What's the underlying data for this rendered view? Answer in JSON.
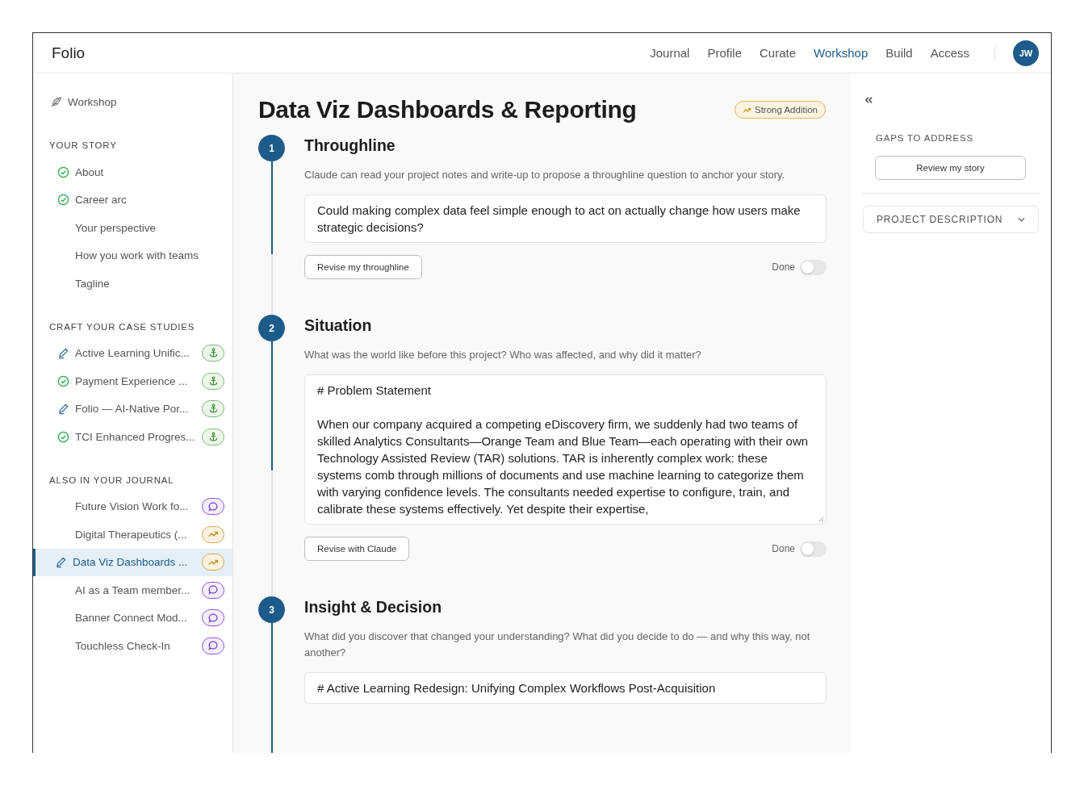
{
  "app": {
    "name": "Folio"
  },
  "nav": [
    {
      "label": "Journal",
      "selected": false
    },
    {
      "label": "Profile",
      "selected": false
    },
    {
      "label": "Curate",
      "selected": false
    },
    {
      "label": "Workshop",
      "selected": true
    },
    {
      "label": "Build",
      "selected": false
    },
    {
      "label": "Access",
      "selected": false
    }
  ],
  "avatar": {
    "initials": "JW"
  },
  "sidebar": {
    "title": "Workshop",
    "groups": [
      {
        "heading": "YOUR STORY",
        "items": [
          {
            "label": "About",
            "kind": "complete",
            "selected": false
          },
          {
            "label": "Career arc",
            "kind": "complete",
            "selected": false
          },
          {
            "label": "Your perspective",
            "kind": "plain",
            "selected": false
          },
          {
            "label": "How you work with teams",
            "kind": "plain",
            "selected": false
          },
          {
            "label": "Tagline",
            "kind": "plain",
            "selected": false
          }
        ]
      },
      {
        "heading": "CRAFT YOUR CASE STUDIES",
        "items": [
          {
            "label": "Active Learning Unific...",
            "kind": "editing",
            "badge": {
              "kind": "anchor"
            },
            "selected": false
          },
          {
            "label": "Payment Experience ...",
            "kind": "complete",
            "badge": {
              "kind": "anchor"
            },
            "selected": false
          },
          {
            "label": "Folio — AI-Native Por...",
            "kind": "editing",
            "badge": {
              "kind": "anchor"
            },
            "selected": false
          },
          {
            "label": "TCI Enhanced Progres...",
            "kind": "complete",
            "badge": {
              "kind": "anchor"
            },
            "selected": false
          }
        ]
      },
      {
        "heading": "ALSO IN YOUR JOURNAL",
        "items": [
          {
            "label": "Future Vision Work fo...",
            "kind": "plain",
            "badge": {
              "kind": "chat"
            },
            "selected": false
          },
          {
            "label": "Digital Therapeutics (...",
            "kind": "plain",
            "badge": {
              "kind": "trend"
            },
            "selected": false
          },
          {
            "label": "Data Viz Dashboards ...",
            "kind": "editing",
            "badge": {
              "kind": "trend"
            },
            "selected": true
          },
          {
            "label": "AI as a Team member...",
            "kind": "plain",
            "badge": {
              "kind": "chat"
            },
            "selected": false
          },
          {
            "label": "Banner Connect Mod...",
            "kind": "plain",
            "badge": {
              "kind": "chat"
            },
            "selected": false
          },
          {
            "label": "Touchless Check-In",
            "kind": "plain",
            "badge": {
              "kind": "chat"
            },
            "selected": false
          }
        ]
      }
    ]
  },
  "page": {
    "title": "Data Viz Dashboards & Reporting",
    "tag": "Strong Addition"
  },
  "steps": [
    {
      "number": "1",
      "title": "Throughline",
      "prompt": "Claude can read your project notes and write-up to propose a throughline question to anchor your story.",
      "value": "Could making complex data feel simple enough to act on actually change how users make strategic decisions?",
      "button": "Revise my throughline",
      "done_label": "Done",
      "done": false
    },
    {
      "number": "2",
      "title": "Situation",
      "prompt": "What was the world like before this project? Who was affected, and why did it matter?",
      "value": "# Problem Statement\n\nWhen our company acquired a competing eDiscovery firm, we suddenly had two teams of skilled Analytics Consultants—Orange Team and Blue Team—each operating with their own Technology Assisted Review (TAR) solutions. TAR is inherently complex work: these systems comb through millions of documents and use machine learning to categorize them with varying confidence levels. The consultants needed expertise to configure, train, and calibrate these systems effectively. Yet despite their expertise,",
      "button": "Revise with Claude",
      "done_label": "Done",
      "done": false
    },
    {
      "number": "3",
      "title": "Insight & Decision",
      "prompt": "What did you discover that changed your understanding? What did you decide to do — and why this way, not another?",
      "value": "# Active Learning Redesign: Unifying Complex Workflows Post-Acquisition"
    }
  ],
  "panel": {
    "heading": "GAPS TO ADDRESS",
    "button": "Review my story",
    "section": {
      "label": "PROJECT DESCRIPTION",
      "expanded": false
    }
  }
}
